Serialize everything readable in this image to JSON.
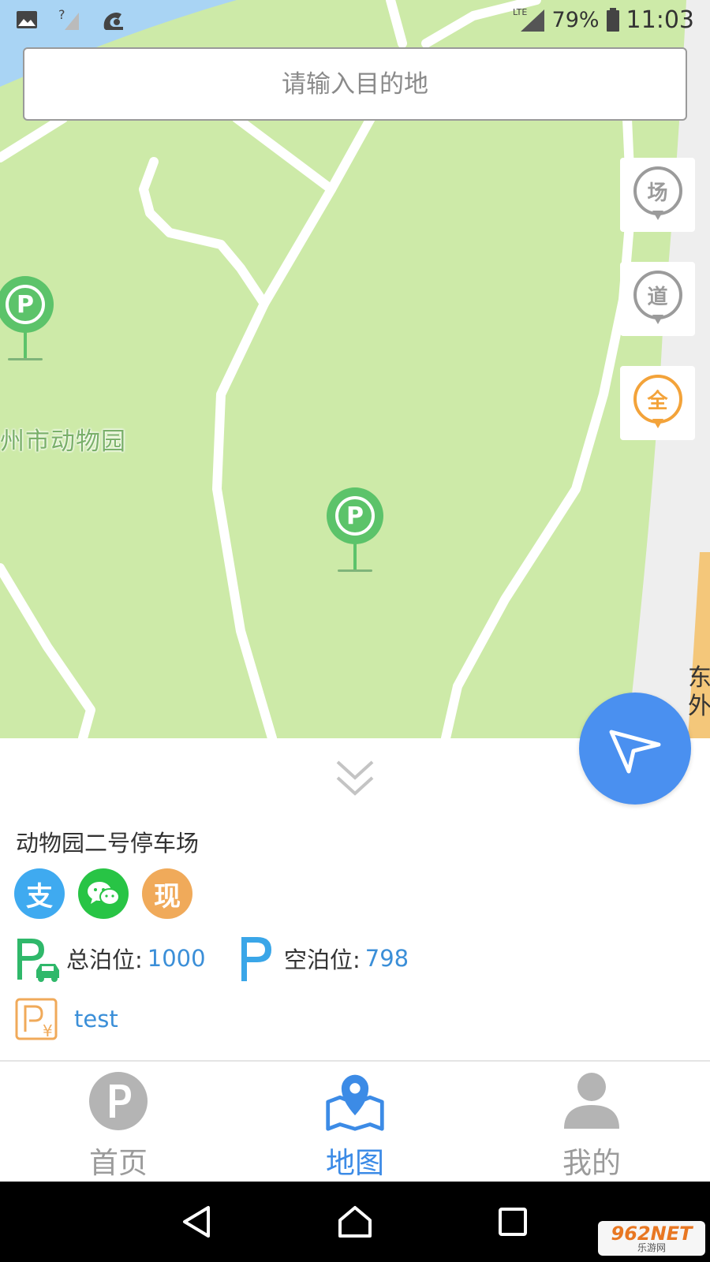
{
  "status_bar": {
    "network": "LTE",
    "battery": "79%",
    "time": "11:03",
    "icons": [
      "image-icon",
      "no-sim-signal-icon",
      "uc-browser-icon",
      "lte-signal-icon",
      "battery-icon"
    ]
  },
  "search": {
    "placeholder": "请输入目的地"
  },
  "map": {
    "label_zoo": "州市动物园",
    "label_side_road": "东外",
    "pin_symbol": "P"
  },
  "filters": [
    {
      "label": "场",
      "color": "#9b9b9b"
    },
    {
      "label": "道",
      "color": "#9b9b9b"
    },
    {
      "label": "全",
      "color": "#f3a33a"
    }
  ],
  "panel": {
    "lot_name": "动物园二号停车场",
    "payments": [
      {
        "name": "alipay",
        "glyph": "支",
        "color": "#3faaf0"
      },
      {
        "name": "wechat-pay",
        "glyph": "",
        "color": "#28c445"
      },
      {
        "name": "cash",
        "glyph": "现",
        "color": "#f0aa5a"
      }
    ],
    "total_label": "总泊位:",
    "total_value": "1000",
    "empty_label": "空泊位:",
    "empty_value": "798",
    "price_text": "test"
  },
  "tabs": [
    {
      "label": "首页",
      "icon": "parking-p-icon",
      "active": false
    },
    {
      "label": "地图",
      "icon": "map-pin-icon",
      "active": true
    },
    {
      "label": "我的",
      "icon": "person-icon",
      "active": false
    }
  ],
  "watermark": {
    "line1": "962NET",
    "line2": "乐游网"
  },
  "colors": {
    "accent": "#3c8be6",
    "map_green": "#cdeaa8",
    "pin_green": "#5cc36a",
    "fab_blue": "#4a90f0"
  }
}
